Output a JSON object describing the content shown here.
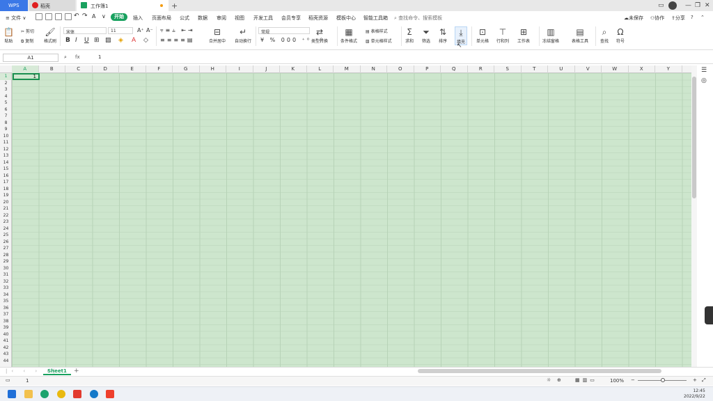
{
  "tabs": {
    "wps": "WPS",
    "daoke": "稻壳",
    "workbook": "工作簿1"
  },
  "window_controls": [
    "▭",
    "—",
    "❐",
    "✕"
  ],
  "menu": {
    "file": "≡ 文件 ∨",
    "items": [
      "插入",
      "页面布局",
      "公式",
      "数据",
      "审阅",
      "视图",
      "开发工具",
      "会员专享",
      "稻壳资源",
      "模板中心",
      "智能工具箱"
    ],
    "start": "开始",
    "search": "查找命令、搜索模板",
    "unsaved": "未保存",
    "collab": "协作",
    "share": "分享"
  },
  "ribbon": {
    "paste": "粘贴",
    "cut": "剪切",
    "copy": "复制",
    "format_painter": "格式刷",
    "font_name": "宋体",
    "font_size": "11",
    "merge": "合并居中",
    "wrap": "自动换行",
    "number_format": "常规",
    "convert": "类型转换",
    "cond_format": "条件格式",
    "table_style": "表格样式",
    "cell_style": "单元格样式",
    "sum": "求和",
    "filter": "筛选",
    "sort": "排序",
    "fill": "填充",
    "cell": "单元格",
    "rowcol": "行和列",
    "worksheet": "工作表",
    "freeze": "冻结窗格",
    "table_tools": "表格工具",
    "find": "查找",
    "symbol": "符号"
  },
  "formula_bar": {
    "name_box": "A1",
    "fx": "fx",
    "value": "1"
  },
  "grid": {
    "columns": [
      "A",
      "B",
      "C",
      "D",
      "E",
      "F",
      "G",
      "H",
      "I",
      "J",
      "K",
      "L",
      "M",
      "N",
      "O",
      "P",
      "Q",
      "R",
      "S",
      "T",
      "U",
      "V",
      "W",
      "X",
      "Y"
    ],
    "rows": [
      "1",
      "2",
      "3",
      "4",
      "5",
      "6",
      "7",
      "8",
      "9",
      "10",
      "11",
      "12",
      "13",
      "14",
      "15",
      "16",
      "17",
      "18",
      "19",
      "20",
      "21",
      "22",
      "23",
      "24",
      "25",
      "26",
      "27",
      "28",
      "29",
      "30",
      "31",
      "32",
      "33",
      "34",
      "35",
      "36",
      "37",
      "38",
      "39",
      "40",
      "41",
      "42",
      "43",
      "44"
    ],
    "a1_value": "1"
  },
  "sheet_tab": "Sheet1",
  "status": {
    "cell_value": "1",
    "zoom": "100%"
  },
  "clock": {
    "time": "12:45",
    "date": "2022/9/22"
  },
  "colors": {
    "brand_green": "#19a15f",
    "cell_bg": "#cde6cd",
    "wps_blue": "#3b78e7"
  }
}
